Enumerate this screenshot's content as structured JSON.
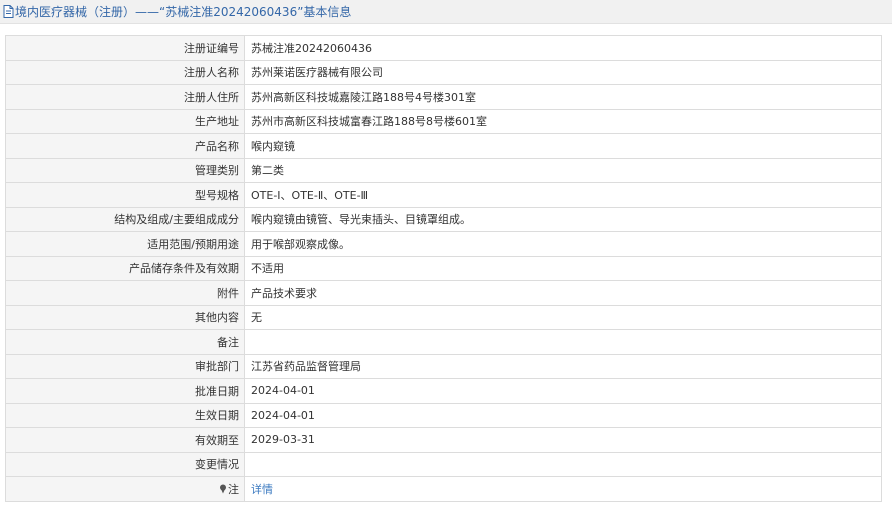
{
  "header": {
    "icon": "document-icon",
    "title": "境内医疗器械（注册）——“苏械注准20242060436”基本信息"
  },
  "rows": [
    {
      "label": "注册证编号",
      "value": "苏械注准20242060436"
    },
    {
      "label": "注册人名称",
      "value": "苏州莱诺医疗器械有限公司"
    },
    {
      "label": "注册人住所",
      "value": "苏州高新区科技城嘉陵江路188号4号楼301室"
    },
    {
      "label": "生产地址",
      "value": "苏州市高新区科技城富春江路188号8号楼601室"
    },
    {
      "label": "产品名称",
      "value": "喉内窥镜"
    },
    {
      "label": "管理类别",
      "value": "第二类"
    },
    {
      "label": "型号规格",
      "value": "OTE-Ⅰ、OTE-Ⅱ、OTE-Ⅲ"
    },
    {
      "label": "结构及组成/主要组成成分",
      "value": "喉内窥镜由镜管、导光束插头、目镜罩组成。"
    },
    {
      "label": "适用范围/预期用途",
      "value": "用于喉部观察成像。"
    },
    {
      "label": "产品储存条件及有效期",
      "value": "不适用"
    },
    {
      "label": "附件",
      "value": "产品技术要求"
    },
    {
      "label": "其他内容",
      "value": "无"
    },
    {
      "label": "备注",
      "value": ""
    },
    {
      "label": "审批部门",
      "value": "江苏省药品监督管理局"
    },
    {
      "label": "批准日期",
      "value": "2024-04-01"
    },
    {
      "label": "生效日期",
      "value": "2024-04-01"
    },
    {
      "label": "有效期至",
      "value": "2029-03-31"
    },
    {
      "label": "变更情况",
      "value": ""
    }
  ],
  "note": {
    "icon": "pin-icon",
    "label": "注",
    "link": "详情"
  }
}
